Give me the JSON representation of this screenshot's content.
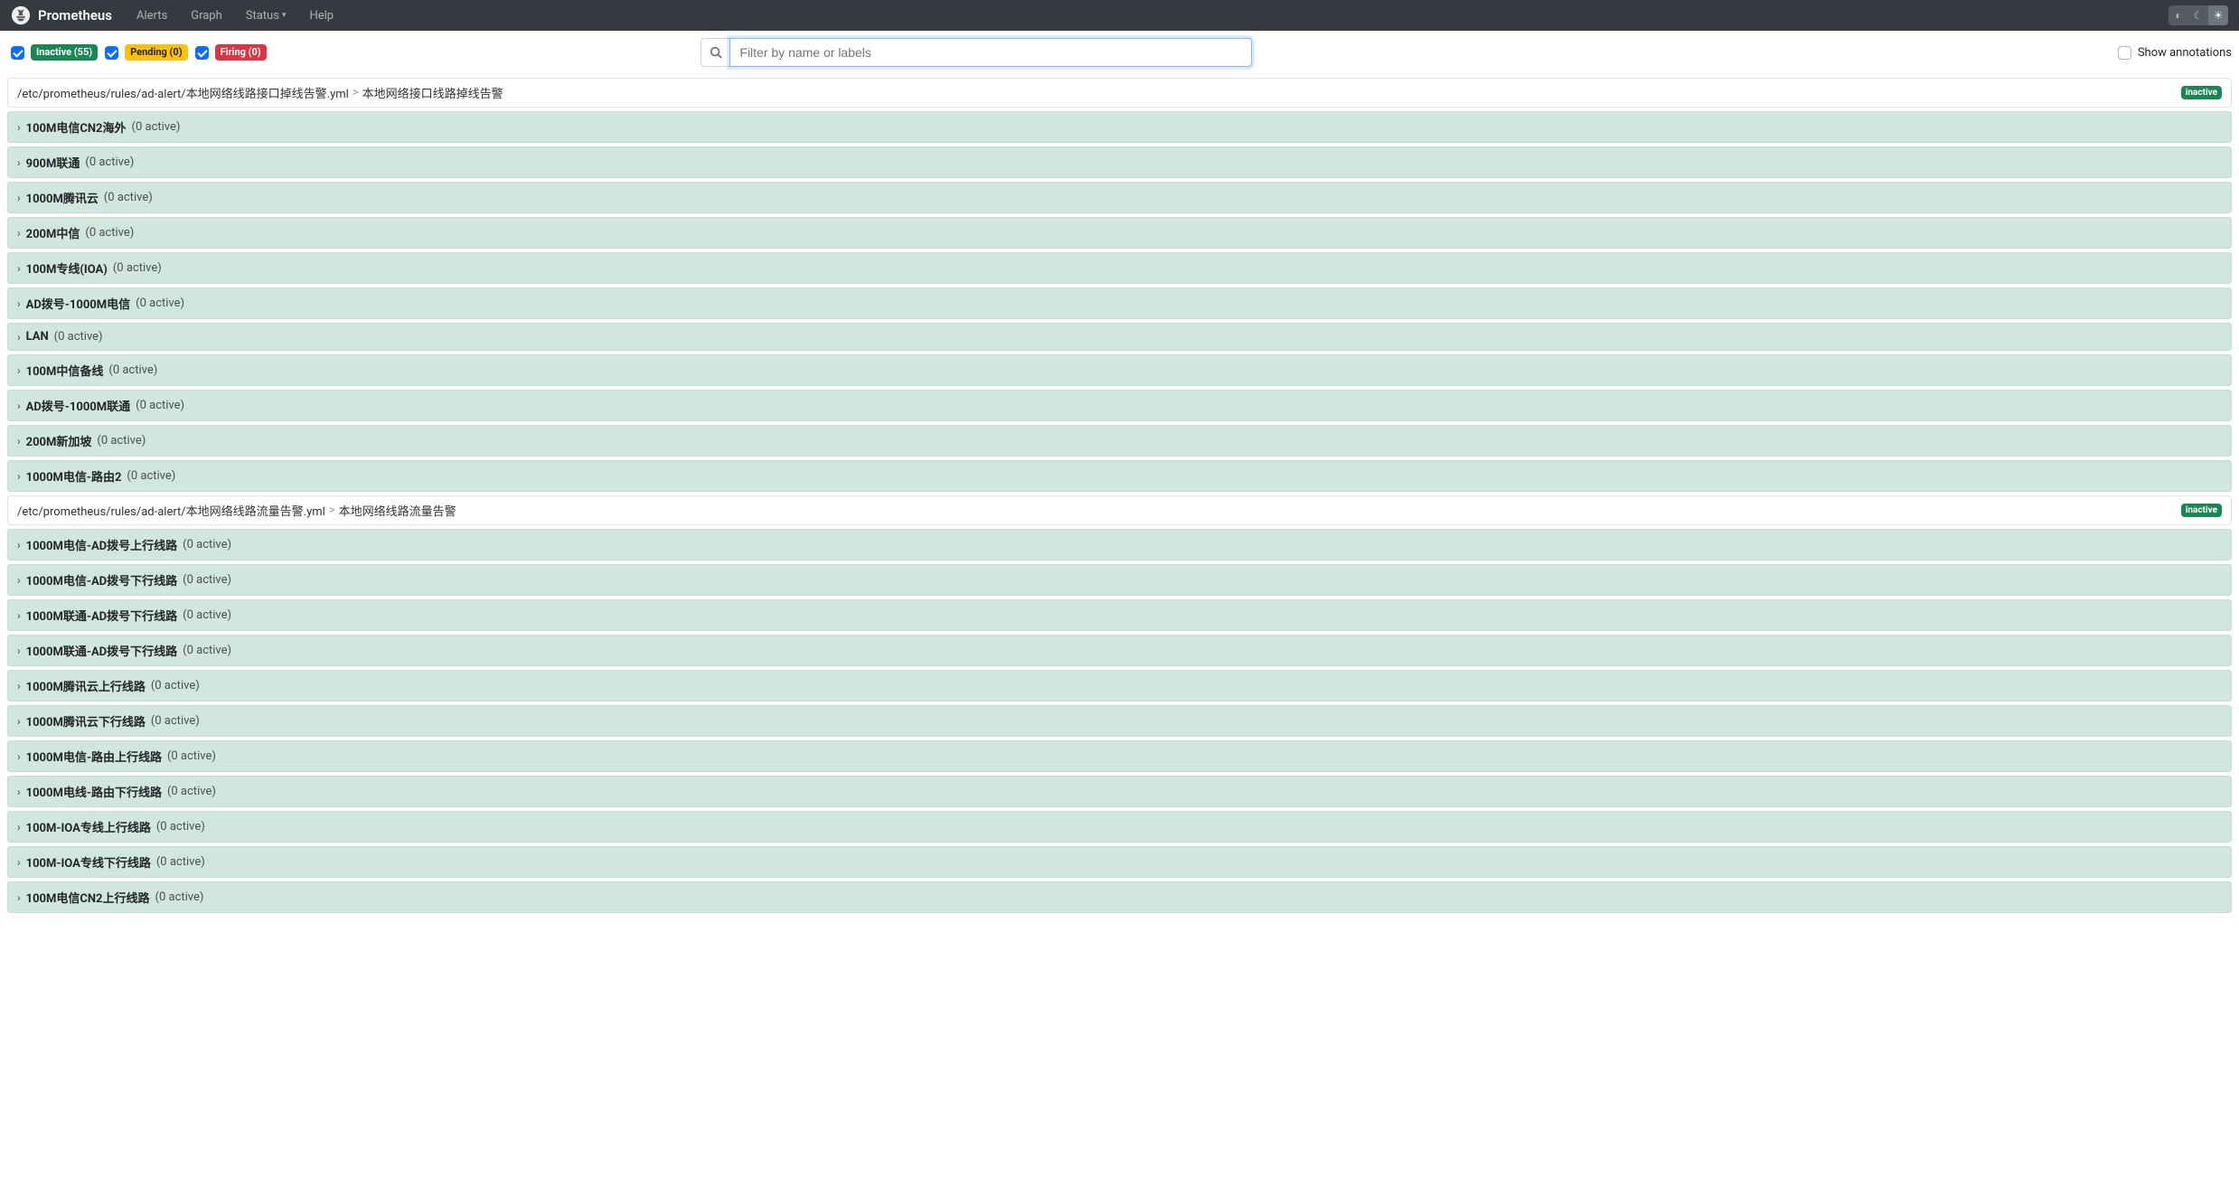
{
  "navbar": {
    "brand": "Prometheus",
    "links": {
      "alerts": "Alerts",
      "graph": "Graph",
      "status": "Status",
      "help": "Help"
    }
  },
  "filters": {
    "inactive_label": "Inactive (55)",
    "pending_label": "Pending (0)",
    "firing_label": "Firing (0)"
  },
  "search": {
    "placeholder": "Filter by name or labels"
  },
  "show_annotations_label": "Show annotations",
  "groups": [
    {
      "path": "/etc/prometheus/rules/ad-alert/本地网络线路接口掉线告警.yml",
      "name": "本地网络接口线路掉线告警",
      "status": "inactive",
      "rules": [
        {
          "name": "100M电信CN2海外",
          "active": "(0 active)"
        },
        {
          "name": "900M联通",
          "active": "(0 active)"
        },
        {
          "name": "1000M腾讯云",
          "active": "(0 active)"
        },
        {
          "name": "200M中信",
          "active": "(0 active)"
        },
        {
          "name": "100M专线(IOA)",
          "active": "(0 active)"
        },
        {
          "name": "AD拨号-1000M电信",
          "active": "(0 active)"
        },
        {
          "name": "LAN",
          "active": "(0 active)"
        },
        {
          "name": "100M中信备线",
          "active": "(0 active)"
        },
        {
          "name": "AD拨号-1000M联通",
          "active": "(0 active)"
        },
        {
          "name": "200M新加坡",
          "active": "(0 active)"
        },
        {
          "name": "1000M电信-路由2",
          "active": "(0 active)"
        }
      ]
    },
    {
      "path": "/etc/prometheus/rules/ad-alert/本地网络线路流量告警.yml",
      "name": "本地网络线路流量告警",
      "status": "inactive",
      "rules": [
        {
          "name": "1000M电信-AD拨号上行线路",
          "active": "(0 active)"
        },
        {
          "name": "1000M电信-AD拨号下行线路",
          "active": "(0 active)"
        },
        {
          "name": "1000M联通-AD拨号下行线路",
          "active": "(0 active)"
        },
        {
          "name": "1000M联通-AD拨号下行线路",
          "active": "(0 active)"
        },
        {
          "name": "1000M腾讯云上行线路",
          "active": "(0 active)"
        },
        {
          "name": "1000M腾讯云下行线路",
          "active": "(0 active)"
        },
        {
          "name": "1000M电信-路由上行线路",
          "active": "(0 active)"
        },
        {
          "name": "1000M电线-路由下行线路",
          "active": "(0 active)"
        },
        {
          "name": "100M-IOA专线上行线路",
          "active": "(0 active)"
        },
        {
          "name": "100M-IOA专线下行线路",
          "active": "(0 active)"
        },
        {
          "name": "100M电信CN2上行线路",
          "active": "(0 active)"
        }
      ]
    }
  ]
}
